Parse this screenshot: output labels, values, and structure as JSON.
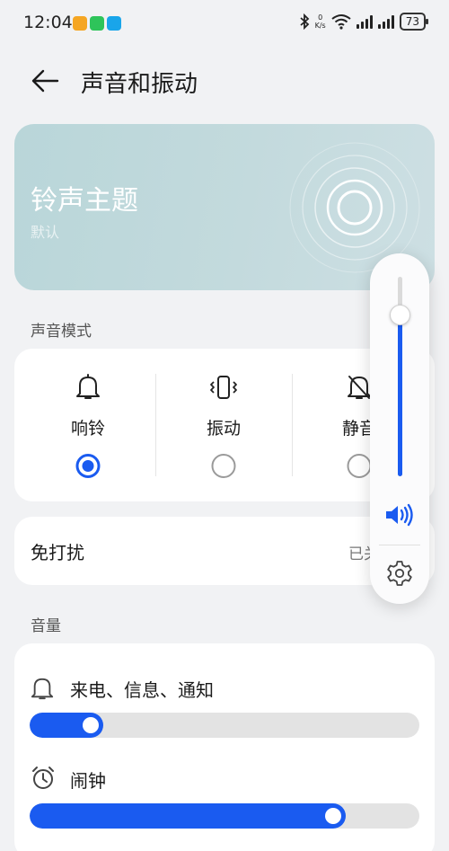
{
  "status_bar": {
    "time": "12:04",
    "net_speed_value": "0",
    "net_speed_unit": "K/s",
    "battery": "73",
    "app_badge_colors": [
      "#f5a623",
      "#2ec45a",
      "#19a5ea"
    ]
  },
  "header": {
    "title": "声音和振动",
    "back_icon": "back-arrow-icon"
  },
  "ringtone": {
    "title": "铃声主题",
    "subtitle": "默认"
  },
  "sound_mode": {
    "section_label": "声音模式",
    "options": [
      {
        "label": "响铃",
        "icon": "bell-icon",
        "selected": true
      },
      {
        "label": "振动",
        "icon": "vibrate-icon",
        "selected": false
      },
      {
        "label": "静音",
        "icon": "bell-off-icon",
        "selected": false
      }
    ]
  },
  "dnd": {
    "label": "免打扰",
    "status": "已关闭"
  },
  "volume": {
    "section_label": "音量",
    "rows": [
      {
        "label": "来电、信息、通知",
        "icon": "bell-icon",
        "level": 0.19
      },
      {
        "label": "闹钟",
        "icon": "alarm-clock-icon",
        "level": 0.81
      }
    ]
  },
  "volume_panel": {
    "level": 0.81,
    "speaker_icon": "speaker-icon",
    "settings_icon": "gear-icon"
  },
  "colors": {
    "accent": "#1a5bf0",
    "background": "#f1f2f4"
  }
}
